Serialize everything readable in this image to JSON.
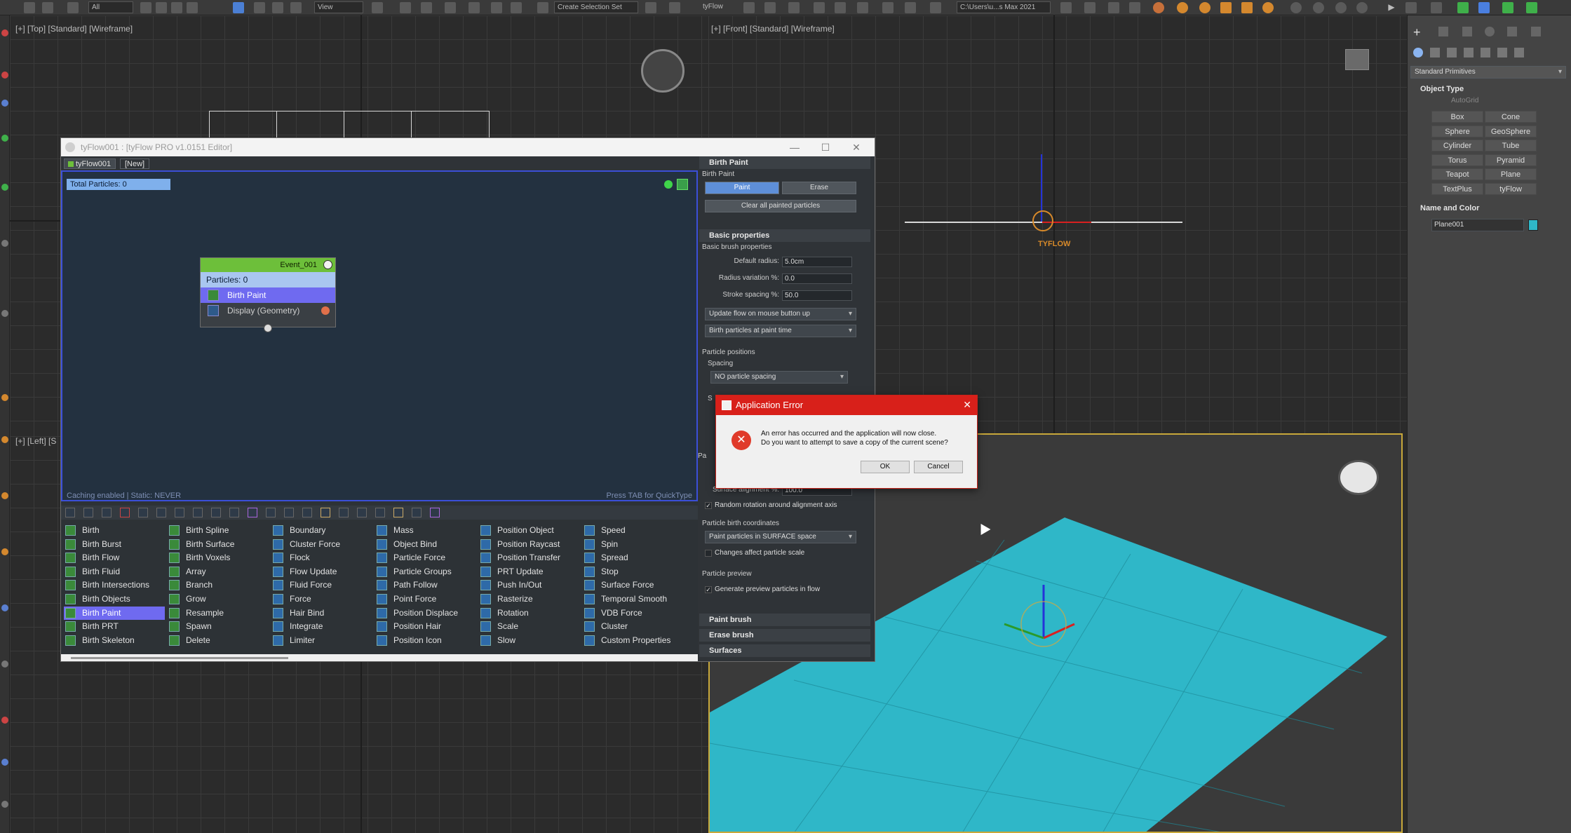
{
  "toolbar": {
    "selection_filter": "All",
    "view_dropdown": "View",
    "selection_set": "Create Selection Set",
    "tyflow_label": "tyFlow",
    "path": "C:\\Users\\u...s Max 2021"
  },
  "viewports": {
    "top_label": "[+] [Top] [Standard] [Wireframe]",
    "front_label": "[+] [Front] [Standard] [Wireframe]",
    "left_label": "[+] [Left] [S",
    "tyflow_gizmo": "TYFLOW"
  },
  "tyflow_editor": {
    "title": "tyFlow001 : [tyFlow PRO v1.0151 Editor]",
    "tabs": [
      "tyFlow001",
      "[New]"
    ],
    "total_particles": "Total Particles: 0",
    "event": {
      "name": "Event_001",
      "particles": "Particles: 0",
      "operators": [
        "Birth Paint",
        "Display (Geometry)"
      ]
    },
    "status": "Caching enabled | Static: NEVER",
    "quicktype": "Press TAB for QuickType",
    "operators": {
      "col1": [
        "Birth",
        "Birth Burst",
        "Birth Flow",
        "Birth Fluid",
        "Birth Intersections",
        "Birth Objects",
        "Birth Paint",
        "Birth PRT",
        "Birth Skeleton"
      ],
      "col2": [
        "Birth Spline",
        "Birth Surface",
        "Birth Voxels",
        "Array",
        "Branch",
        "Grow",
        "Resample",
        "Spawn",
        "Delete"
      ],
      "col3": [
        "Boundary",
        "Cluster Force",
        "Flock",
        "Flow Update",
        "Fluid Force",
        "Force",
        "Hair Bind",
        "Integrate",
        "Limiter"
      ],
      "col4": [
        "Mass",
        "Object Bind",
        "Particle Force",
        "Particle Groups",
        "Path Follow",
        "Point Force",
        "Position Displace",
        "Position Hair",
        "Position Icon"
      ],
      "col5": [
        "Position Object",
        "Position Raycast",
        "Position Transfer",
        "PRT Update",
        "Push In/Out",
        "Rasterize",
        "Rotation",
        "Scale",
        "Slow"
      ],
      "col6": [
        "Speed",
        "Spin",
        "Spread",
        "Stop",
        "Surface Force",
        "Temporal Smooth",
        "VDB Force",
        "Cluster",
        "Custom Properties"
      ]
    },
    "selected_operator": "Birth Paint"
  },
  "props": {
    "birth_paint_section": "Birth Paint",
    "birth_paint_sub": "Birth Paint",
    "paint_btn": "Paint",
    "erase_btn": "Erase",
    "clear_btn": "Clear all painted particles",
    "basic_section": "Basic properties",
    "basic_sub": "Basic brush properties",
    "default_radius_label": "Default radius:",
    "default_radius": "5.0cm",
    "radius_var_label": "Radius variation %:",
    "radius_var": "0.0",
    "stroke_spacing_label": "Stroke spacing %:",
    "stroke_spacing": "50.0",
    "update_flow": "Update flow on mouse button up",
    "birth_time": "Birth particles at paint time",
    "positions_sub": "Particle positions",
    "spacing_sub": "Spacing",
    "spacing_dd": "NO particle spacing",
    "hidden_s": "S",
    "hidden_pa": "Pa",
    "surface_align_label": "Surface alignment %:",
    "surface_align": "100.0",
    "random_rotation": "Random rotation around alignment axis",
    "birth_coords_sub": "Particle birth coordinates",
    "birth_coords_dd": "Paint particles in SURFACE space",
    "changes_scale": "Changes affect particle scale",
    "preview_sub": "Particle preview",
    "generate_preview": "Generate preview particles in flow",
    "paint_brush_section": "Paint brush",
    "erase_brush_section": "Erase brush",
    "surfaces_section": "Surfaces"
  },
  "dialog": {
    "title": "Application Error",
    "line1": "An error has occurred and the application will now close.",
    "line2": "Do you want to attempt to save a copy of the current scene?",
    "ok": "OK",
    "cancel": "Cancel"
  },
  "command_panel": {
    "category": "Standard Primitives",
    "object_type": "Object Type",
    "autogrid": "AutoGrid",
    "buttons": [
      "Box",
      "Cone",
      "Sphere",
      "GeoSphere",
      "Cylinder",
      "Tube",
      "Torus",
      "Pyramid",
      "Teapot",
      "Plane",
      "TextPlus",
      "tyFlow"
    ],
    "name_color": "Name and Color",
    "object_name": "Plane001",
    "object_color": "#2fb7c8"
  },
  "colors": {
    "accent_blue": "#3b4fd8",
    "event_green": "#6dbf3a",
    "selected_op": "#6f6af0",
    "error_red": "#d8201a",
    "plane_cyan": "#2fb7c8"
  }
}
